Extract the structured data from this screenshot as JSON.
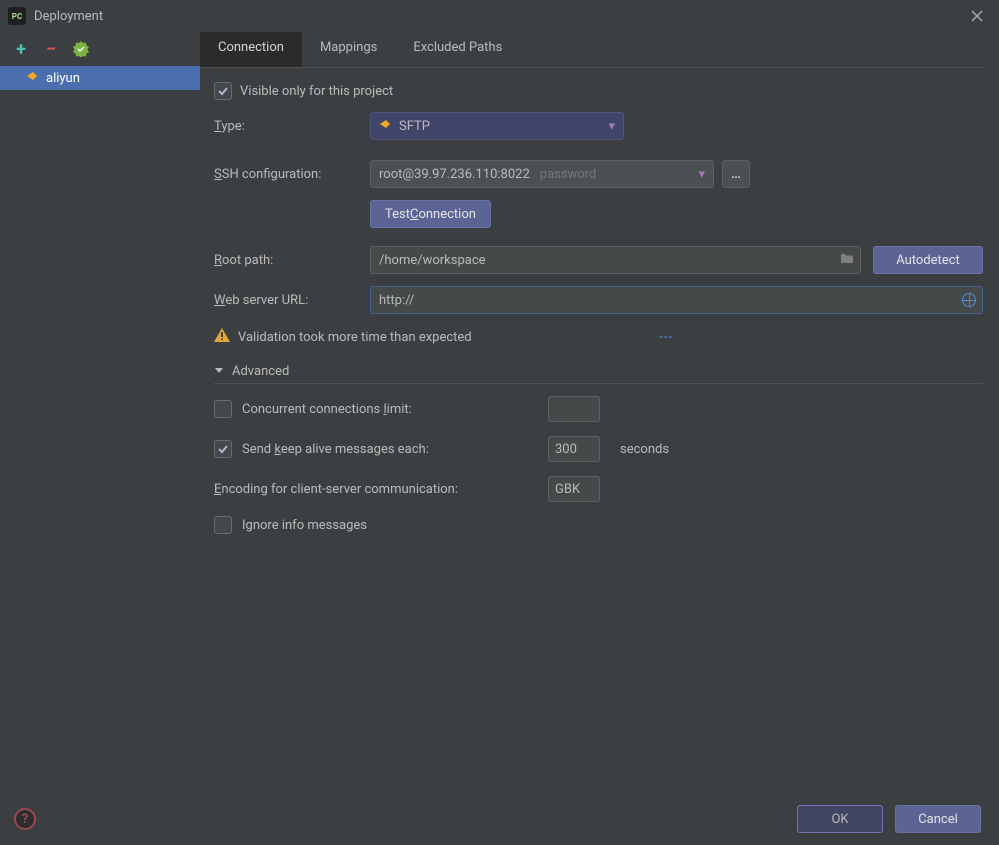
{
  "window": {
    "title": "Deployment"
  },
  "sidebar": {
    "items": [
      {
        "label": "aliyun"
      }
    ]
  },
  "tabs": [
    {
      "label": "Connection",
      "active": true
    },
    {
      "label": "Mappings",
      "active": false
    },
    {
      "label": "Excluded Paths",
      "active": false
    }
  ],
  "form": {
    "visible_only_label": "Visible only for this project",
    "visible_only_checked": true,
    "type_label": "Type:",
    "type_value": "SFTP",
    "ssh_label": "SSH configuration:",
    "ssh_value": "root@39.97.236.110:8022",
    "ssh_auth_hint": "password",
    "test_connection_label": "Test Connection",
    "root_path_label": "Root path:",
    "root_path_value": "/home/workspace",
    "autodetect_label": "Autodetect",
    "web_url_label": "Web server URL:",
    "web_url_value": "http://",
    "validation_message": "Validation took more time than expected",
    "more_link": "---",
    "advanced_label": "Advanced",
    "concurrent_label": "Concurrent connections limit:",
    "concurrent_checked": false,
    "concurrent_value": "",
    "keepalive_label": "Send keep alive messages each:",
    "keepalive_checked": true,
    "keepalive_value": "300",
    "keepalive_suffix": "seconds",
    "encoding_label": "Encoding for client-server communication:",
    "encoding_value": "GBK",
    "ignore_info_label": "Ignore info messages",
    "ignore_info_checked": false
  },
  "footer": {
    "ok_label": "OK",
    "cancel_label": "Cancel"
  }
}
